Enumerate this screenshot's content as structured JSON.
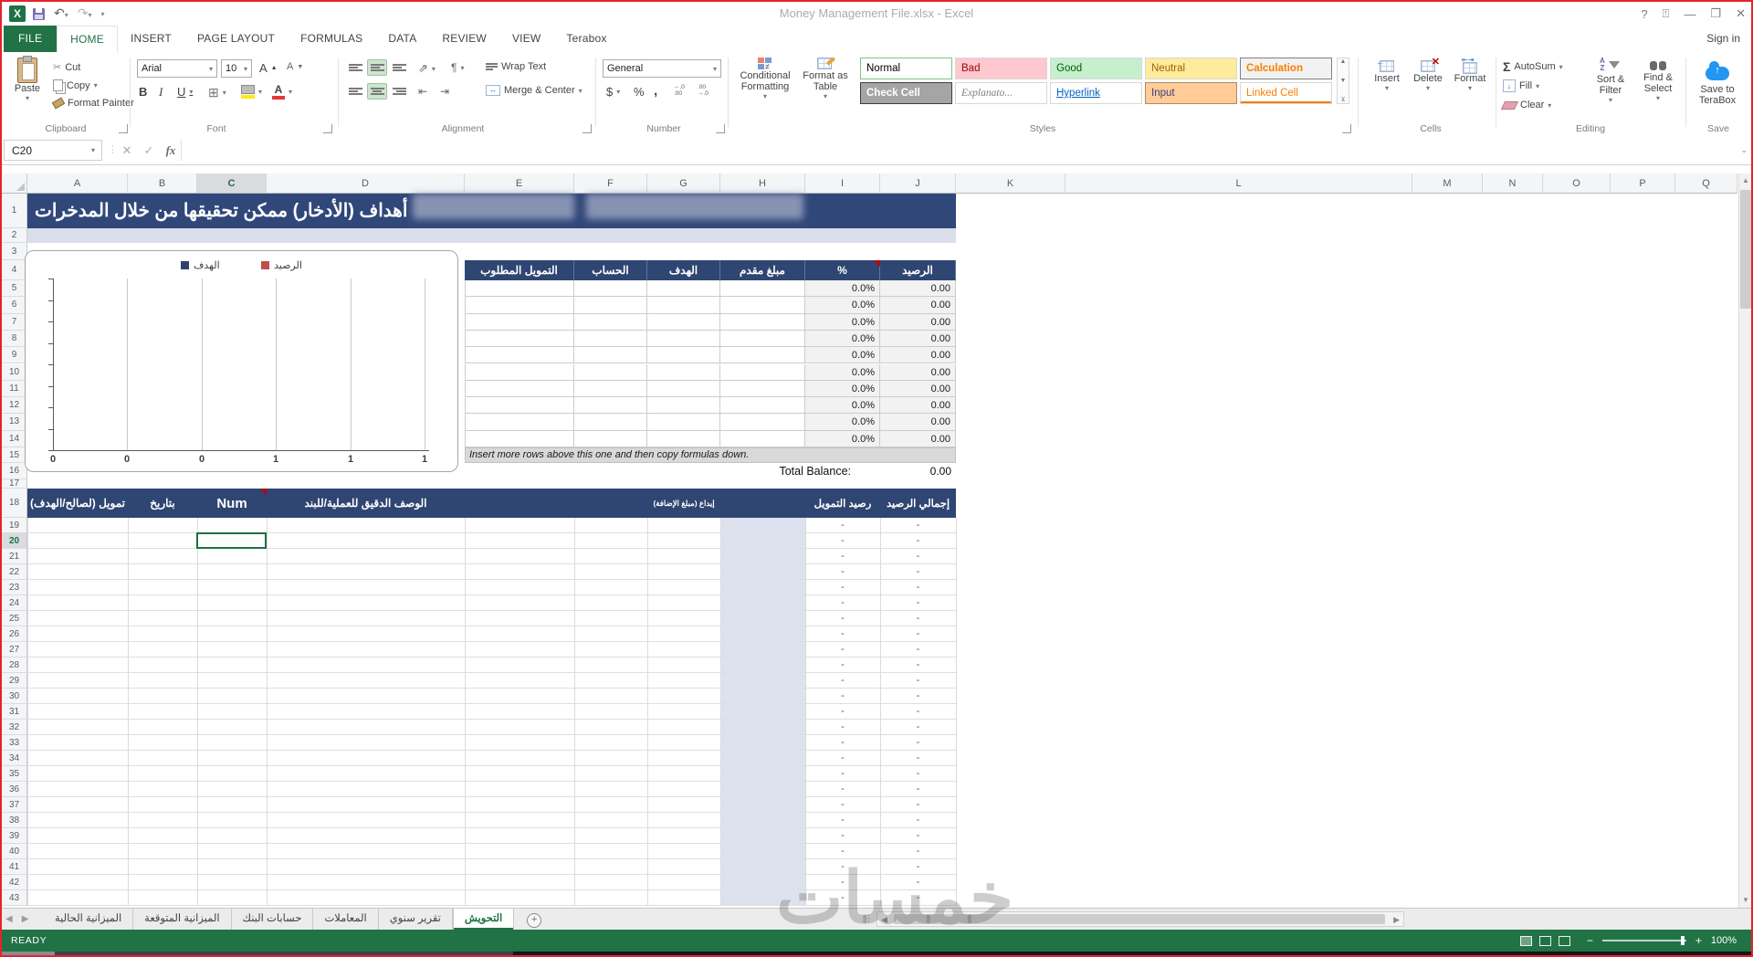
{
  "window": {
    "title": "Money Management File.xlsx - Excel",
    "sign_in": "Sign in"
  },
  "ribbon": {
    "tabs": [
      {
        "label": "FILE",
        "active": false
      },
      {
        "label": "HOME",
        "active": true
      },
      {
        "label": "INSERT",
        "active": false
      },
      {
        "label": "PAGE LAYOUT",
        "active": false
      },
      {
        "label": "FORMULAS",
        "active": false
      },
      {
        "label": "DATA",
        "active": false
      },
      {
        "label": "REVIEW",
        "active": false
      },
      {
        "label": "VIEW",
        "active": false
      },
      {
        "label": "Terabox",
        "active": false
      }
    ],
    "groups": [
      "Clipboard",
      "Font",
      "Alignment",
      "Number",
      "Styles",
      "Cells",
      "Editing",
      "Save"
    ],
    "clipboard": {
      "paste": "Paste",
      "cut": "Cut",
      "copy": "Copy",
      "format_painter": "Format Painter"
    },
    "font": {
      "name": "Arial",
      "size": "10",
      "bold": "B",
      "italic": "I",
      "underline": "U"
    },
    "alignment": {
      "wrap": "Wrap Text",
      "merge": "Merge & Center"
    },
    "number": {
      "format": "General",
      "currency": "$",
      "percent": "%",
      "comma": ","
    },
    "styles": {
      "conditional": "Conditional Formatting",
      "format_table": "Format as Table",
      "items": [
        {
          "label": "Normal",
          "fg": "#000000",
          "bg": "#FFFFFF",
          "border": "#7EC482"
        },
        {
          "label": "Bad",
          "fg": "#9C0006",
          "bg": "#FFC7CE"
        },
        {
          "label": "Good",
          "fg": "#006100",
          "bg": "#C6EFCE"
        },
        {
          "label": "Neutral",
          "fg": "#9C6500",
          "bg": "#FFEB9C"
        },
        {
          "label": "Calculation",
          "fg": "#FA7D00",
          "bg": "#F2F2F2",
          "border": "#7F7F7F",
          "bold": true
        },
        {
          "label": "Check Cell",
          "fg": "#FFFFFF",
          "bg": "#A5A5A5",
          "border": "#3F3F3F",
          "bold": true
        },
        {
          "label": "Explanato...",
          "fg": "#7F7F7F",
          "bg": "#FFFFFF",
          "italic": true
        },
        {
          "label": "Hyperlink",
          "fg": "#0563C1",
          "bg": "#FFFFFF",
          "underline": true
        },
        {
          "label": "Input",
          "fg": "#3F3F76",
          "bg": "#FFCC99",
          "border": "#B08C5A"
        },
        {
          "label": "Linked Cell",
          "fg": "#FA7D00",
          "bg": "#FFFFFF",
          "underline2": true
        }
      ]
    },
    "cells": {
      "insert": "Insert",
      "delete": "Delete",
      "format": "Format"
    },
    "editing": {
      "autosum": "AutoSum",
      "fill": "Fill",
      "clear": "Clear",
      "sort": "Sort & Filter",
      "find": "Find & Select"
    },
    "save": {
      "label": "Save to TeraBox"
    }
  },
  "formula_bar": {
    "name_box": "C20",
    "formula": ""
  },
  "grid": {
    "columns": [
      "A",
      "B",
      "C",
      "D",
      "E",
      "F",
      "G",
      "H",
      "I",
      "J",
      "K",
      "L",
      "M",
      "N",
      "O",
      "P",
      "Q"
    ],
    "row_count": 43,
    "selected_cell": "C20"
  },
  "sheet": {
    "banner_title": "أهداف (الأدخار) ممكن تحقيقها من خلال المدخرات",
    "table1": {
      "headers": [
        "التمويل المطلوب",
        "الحساب",
        "الهدف",
        "مبلغ مقدم",
        "%",
        "الرصيد"
      ],
      "row_count": 10,
      "pct_value": "0.0%",
      "balance_value": "0.00",
      "note": "Insert more rows above this one and then copy formulas down.",
      "total_label": "Total Balance:",
      "total_value": "0.00"
    },
    "table2": {
      "headers": [
        "تمويل (لصالح/الهدف)",
        "بتاريخ",
        "Num",
        "الوصف الدقيق للعملية/للبند",
        "إيداع (مبلغ الإضافة)",
        "رصيد التمويل",
        "إجمالي الرصيد"
      ],
      "row_count": 25,
      "dash": "-"
    },
    "watermark": "خمسات"
  },
  "chart_data": {
    "type": "bar",
    "orientation": "horizontal",
    "series": [
      {
        "name": "الهدف",
        "color": "#2E4372",
        "values": []
      },
      {
        "name": "الرصيد",
        "color": "#C0504D",
        "values": []
      }
    ],
    "x_tick_labels": [
      "0",
      "0",
      "0",
      "1",
      "1",
      "1"
    ],
    "xlim": [
      0,
      1
    ],
    "legend_position": "top",
    "grid": true,
    "note": "chart plot area is empty - all goal/balance values are zero"
  },
  "tabs_bar": {
    "sheets": [
      "الميزانية الحالية",
      "الميزانية المتوقعة",
      "حسابات البنك",
      "المعاملات",
      "تقرير سنوي",
      "التحويش"
    ],
    "active_index": 5
  },
  "status_bar": {
    "mode": "READY",
    "zoom": "100%"
  }
}
